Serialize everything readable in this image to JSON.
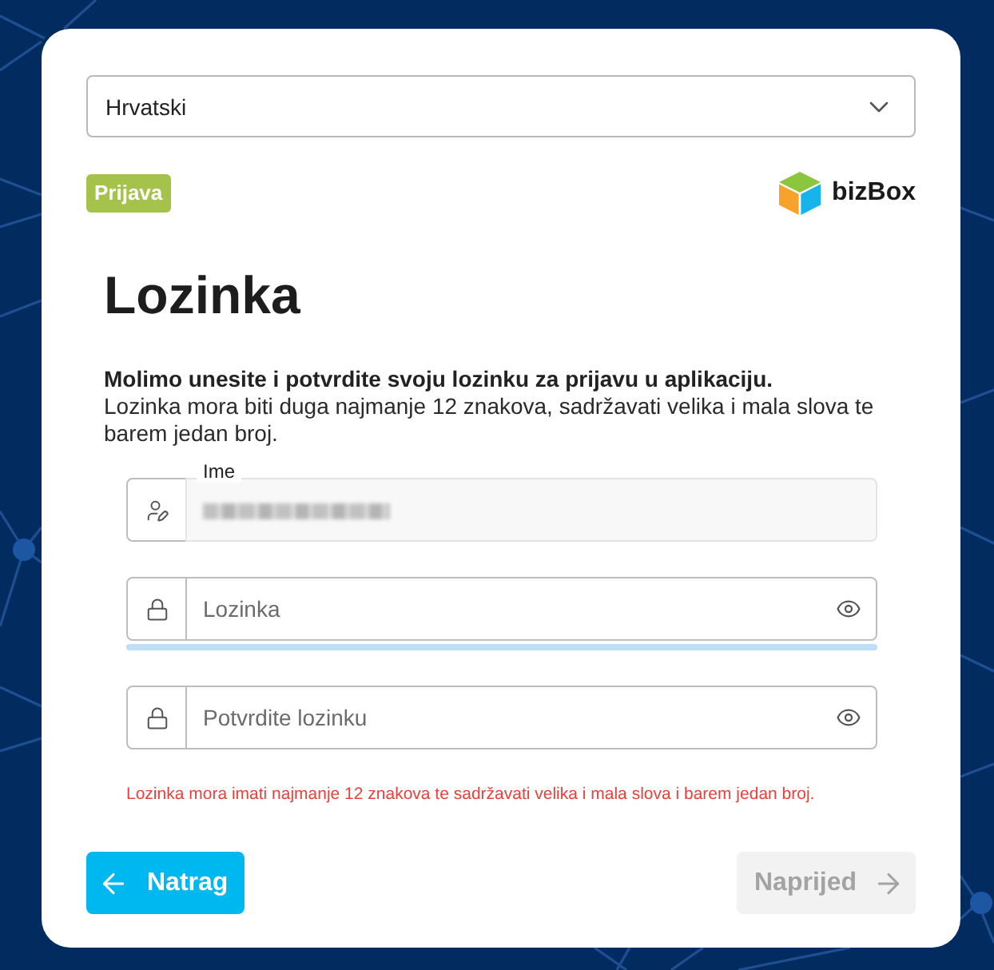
{
  "language_select": {
    "value": "Hrvatski"
  },
  "header": {
    "badge": "Prijava",
    "logo_text": "bizBox"
  },
  "title": "Lozinka",
  "intro": {
    "lead": "Molimo unesite i potvrdite svoju lozinku za prijavu u aplikaciju.",
    "text": "Lozinka mora biti duga najmanje 12 znakova, sadržavati velika i mala slova te barem jedan broj."
  },
  "fields": [
    {
      "kind": "name",
      "label": "Ime",
      "disabled": true,
      "value_blurred": true
    },
    {
      "kind": "password",
      "placeholder": "Lozinka",
      "disabled": false,
      "focused": true
    },
    {
      "kind": "password",
      "placeholder": "Potvrdite lozinku",
      "disabled": false,
      "focused": false
    }
  ],
  "error": "Lozinka mora imati najmanje 12 znakova te sadržavati velika i mala slova i barem jedan broj.",
  "buttons": [
    {
      "kind": "back",
      "label": "Natrag",
      "disabled": false
    },
    {
      "kind": "next",
      "label": "Naprijed",
      "disabled": true
    }
  ]
}
